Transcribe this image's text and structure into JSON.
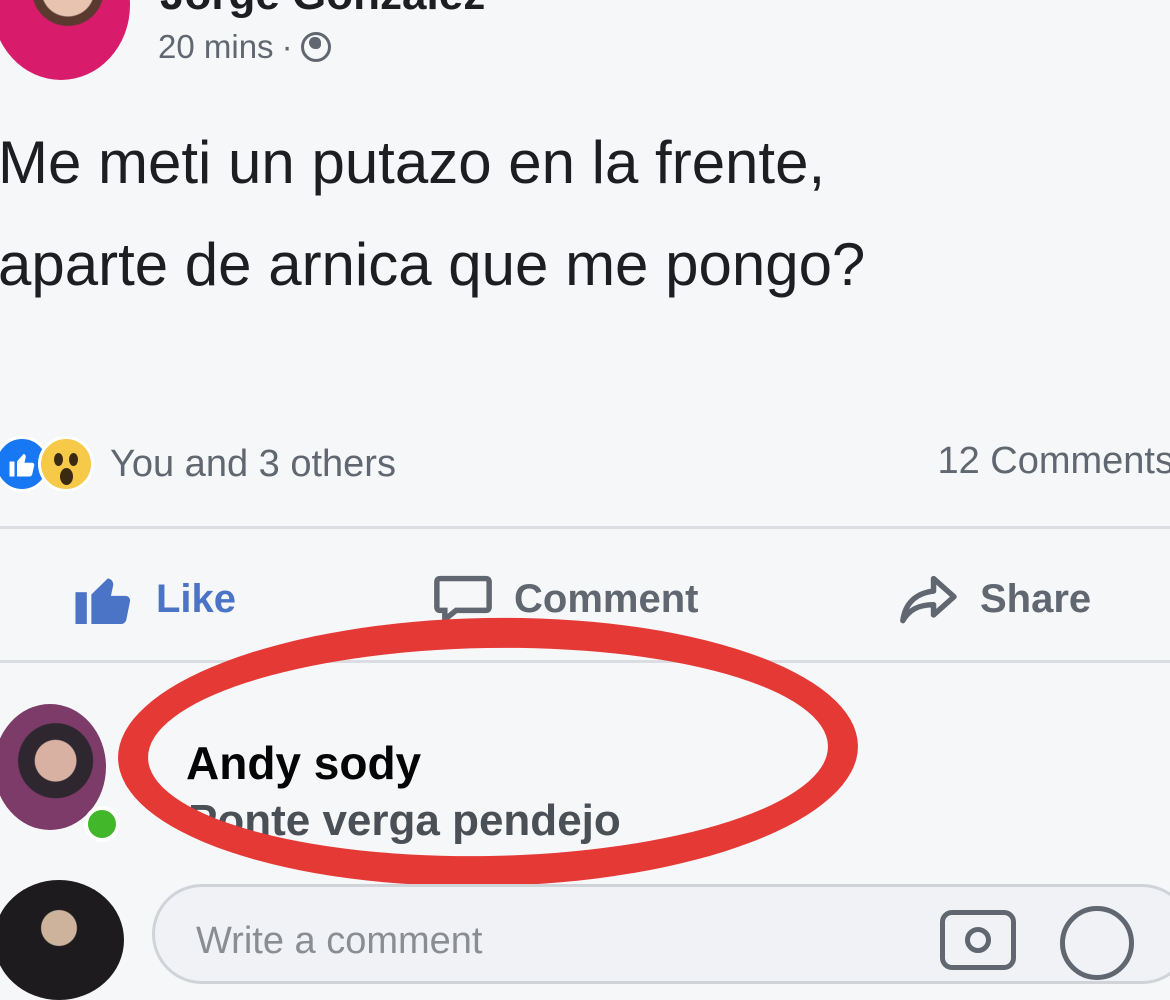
{
  "post": {
    "author": "Jorge Gonzalez",
    "time": "20 mins",
    "separator": "·",
    "text_line1": "Me meti un putazo en la frente,",
    "text_line2": "aparte de arnica que me pongo?"
  },
  "reactions": {
    "summary": "You and 3 others",
    "comments_count": "12 Comments"
  },
  "actions": {
    "like": "Like",
    "comment": "Comment",
    "share": "Share"
  },
  "comment": {
    "author": "Andy sody",
    "text": "Ponte verga pendejo"
  },
  "composer": {
    "placeholder": "Write a comment"
  },
  "colors": {
    "accent": "#1877f2",
    "highlight": "#e53935",
    "online": "#42b72a"
  }
}
